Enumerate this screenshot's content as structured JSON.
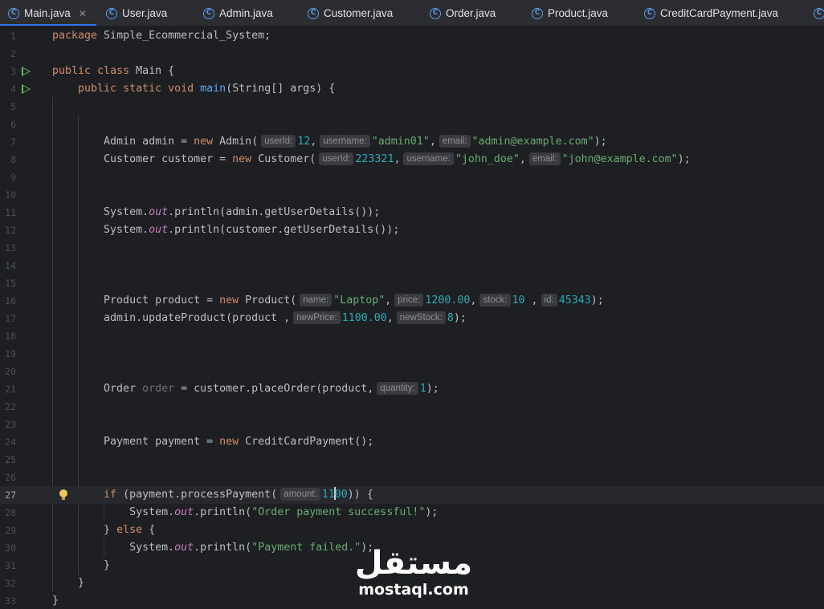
{
  "tabs": [
    {
      "label": "Main.java",
      "active": true,
      "closable": true
    },
    {
      "label": "User.java"
    },
    {
      "label": "Admin.java"
    },
    {
      "label": "Customer.java"
    },
    {
      "label": "Order.java"
    },
    {
      "label": "Product.java"
    },
    {
      "label": "CreditCardPayment.java"
    }
  ],
  "editor": {
    "current_line": 27,
    "line_numbers": [
      "1",
      "2",
      "3",
      "4",
      "5",
      "6",
      "7",
      "8",
      "9",
      "10",
      "11",
      "12",
      "13",
      "14",
      "15",
      "16",
      "17",
      "18",
      "19",
      "20",
      "21",
      "22",
      "23",
      "24",
      "25",
      "26",
      "27",
      "28",
      "29",
      "30",
      "31",
      "32",
      "33"
    ],
    "code": {
      "l1_pkg": "package",
      "l1_name": " Simple_Ecommercial_System;",
      "l3_public": "public",
      "l3_class": " class",
      "l3_main": " Main {",
      "l4_indent": "    ",
      "l4_mods": "public static void",
      "l4_main": "main",
      "l4_args": "(String[] args) {",
      "l7_a": "        Admin admin = ",
      "l7_new": "new",
      "l7_b": " Admin(",
      "l7_h1": "userId:",
      "l7_v1": "12",
      "l7_s1": ",",
      "l7_h2": "username:",
      "l7_v2": "\"admin01\"",
      "l7_s2": ",",
      "l7_h3": "email:",
      "l7_v3": "\"admin@example.com\"",
      "l7_end": ");",
      "l8_a": "        Customer customer = ",
      "l8_new": "new",
      "l8_b": " Customer(",
      "l8_h1": "userId:",
      "l8_v1": "223321",
      "l8_s1": ",",
      "l8_h2": "username:",
      "l8_v2": "\"john_doe\"",
      "l8_s2": ",",
      "l8_h3": "email:",
      "l8_v3": "\"john@example.com\"",
      "l8_end": ");",
      "l11_a": "        System.",
      "l11_out": "out",
      "l11_b": ".println(admin.getUserDetails());",
      "l12_a": "        System.",
      "l12_out": "out",
      "l12_b": ".println(customer.getUserDetails());",
      "l16_a": "        Product product = ",
      "l16_new": "new",
      "l16_b": " Product(",
      "l16_h1": "name:",
      "l16_v1": "\"Laptop\"",
      "l16_s1": ",",
      "l16_h2": "price:",
      "l16_v2": "1200.00",
      "l16_s2": ",",
      "l16_h3": "stock:",
      "l16_v3": "10",
      "l16_s3": " ,",
      "l16_h4": "id:",
      "l16_v4": "45343",
      "l16_end": ");",
      "l17_a": "        admin.updateProduct(product ,",
      "l17_h1": "newPrice:",
      "l17_v1": "1100.00",
      "l17_s1": ",",
      "l17_h2": "newStock:",
      "l17_v2": "8",
      "l17_end": ");",
      "l21_a": "        Order ",
      "l21_var": "order",
      "l21_b": " = customer.placeOrder(product,",
      "l21_h1": "quantity:",
      "l21_v1": "1",
      "l21_end": ");",
      "l24_a": "        Payment payment = ",
      "l24_new": "new",
      "l24_b": " CreditCardPayment();",
      "l27_indent": "        ",
      "l27_if": "if",
      "l27_a": " (payment.processPayment(",
      "l27_h1": "amount:",
      "l27_v1a": "11",
      "l27_v1b": "00",
      "l27_end": ")) {",
      "l28_a": "            System.",
      "l28_out": "out",
      "l28_b": ".println(",
      "l28_str": "\"Order payment successful!\"",
      "l28_end": ");",
      "l29_a": "        } ",
      "l29_else": "else",
      "l29_b": " {",
      "l30_a": "            System.",
      "l30_out": "out",
      "l30_b": ".println(",
      "l30_str": "\"Payment failed.\"",
      "l30_end": ");",
      "l31": "        }",
      "l32": "    }",
      "l33": "}"
    }
  },
  "watermark": {
    "arabic": "مستقل",
    "latin": "mostaql.com"
  },
  "colors": {
    "accent": "#3574f0",
    "keyword": "#cf8e6d",
    "string": "#6aab73",
    "number": "#2aacb8",
    "function": "#56a8f5",
    "field": "#c77dbb"
  }
}
